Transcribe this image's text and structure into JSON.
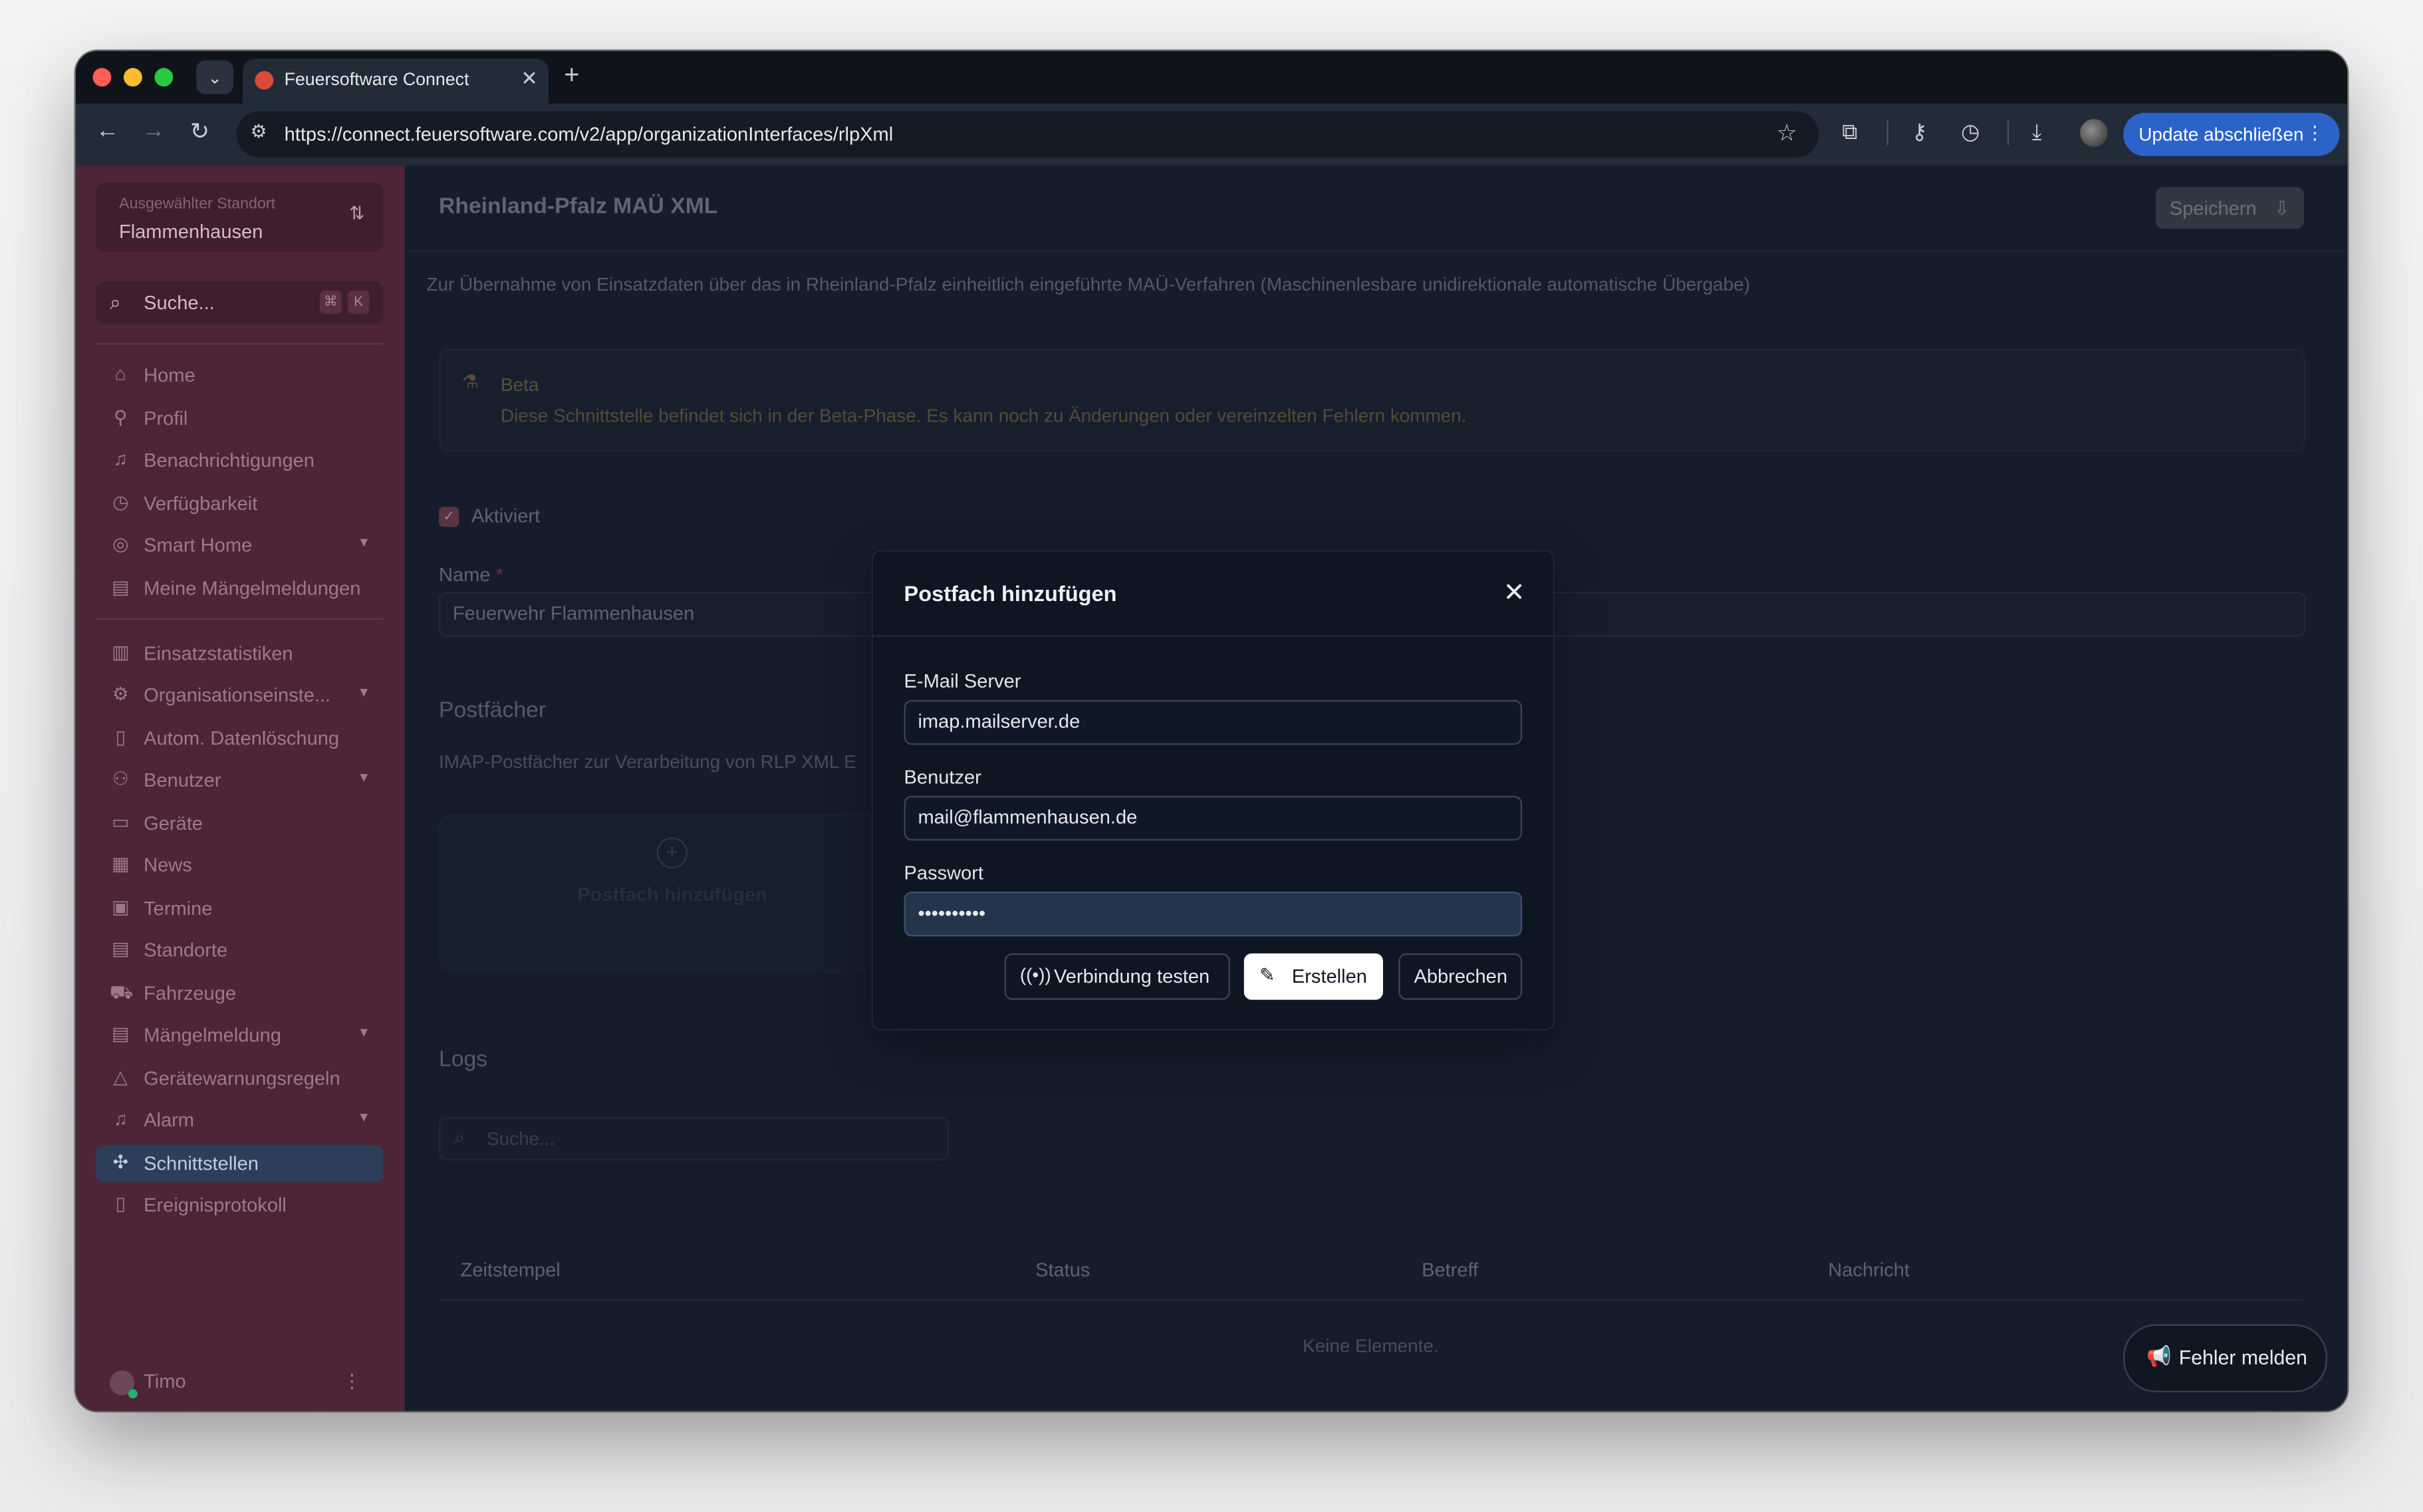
{
  "browser": {
    "tab_title": "Feuersoftware Connect",
    "url": "https://connect.feuersoftware.com/v2/app/organizationInterfaces/rlpXml",
    "update_label": "Update abschließen"
  },
  "sidebar": {
    "location_label": "Ausgewählter Standort",
    "location_value": "Flammenhausen",
    "search_placeholder": "Suche...",
    "kbd_cmd": "⌘",
    "kbd_k": "K",
    "items": [
      {
        "label": "Home",
        "icon": "home-icon"
      },
      {
        "label": "Profil",
        "icon": "user-icon"
      },
      {
        "label": "Benachrichtigungen",
        "icon": "bell-icon"
      },
      {
        "label": "Verfügbarkeit",
        "icon": "clock-icon"
      },
      {
        "label": "Smart Home",
        "icon": "smart-home-icon"
      },
      {
        "label": "Meine Mängelmeldungen",
        "icon": "clipboard-icon"
      },
      {
        "label": "Einsatzstatistiken",
        "icon": "bar-chart-icon"
      },
      {
        "label": "Organisationseinste...",
        "icon": "gear-icon"
      },
      {
        "label": "Autom. Datenlöschung",
        "icon": "trash-icon"
      },
      {
        "label": "Benutzer",
        "icon": "users-icon"
      },
      {
        "label": "Geräte",
        "icon": "monitor-icon"
      },
      {
        "label": "News",
        "icon": "newspaper-icon"
      },
      {
        "label": "Termine",
        "icon": "calendar-icon"
      },
      {
        "label": "Standorte",
        "icon": "building-icon"
      },
      {
        "label": "Fahrzeuge",
        "icon": "truck-icon"
      },
      {
        "label": "Mängelmeldung",
        "icon": "clipboard-icon"
      },
      {
        "label": "Gerätewarnungsregeln",
        "icon": "warning-icon"
      },
      {
        "label": "Alarm",
        "icon": "bell-icon"
      },
      {
        "label": "Schnittstellen",
        "icon": "puzzle-icon"
      },
      {
        "label": "Ereignisprotokoll",
        "icon": "file-icon"
      }
    ],
    "user_name": "Timo"
  },
  "main": {
    "title": "Rheinland-Pfalz MAÜ XML",
    "save_label": "Speichern",
    "description": "Zur Übernahme von Einsatzdaten über das in Rheinland-Pfalz einheitlich eingeführte MAÜ-Verfahren (Maschinenlesbare unidirektionale automatische Übergabe)",
    "beta_title": "Beta",
    "beta_text": "Diese Schnittstelle befindet sich in der Beta-Phase. Es kann noch zu Änderungen oder vereinzelten Fehlern kommen.",
    "activated_label": "Aktiviert",
    "activated": true,
    "name_label": "Name",
    "name_value": "Feuerwehr Flammenhausen",
    "mailboxes_title": "Postfächer",
    "mailboxes_desc": "IMAP-Postfächer zur Verarbeitung von RLP XML E",
    "add_mailbox_label": "Postfach hinzufügen",
    "logs_title": "Logs",
    "logs_search_placeholder": "Suche...",
    "columns": [
      "Zeitstempel",
      "Status",
      "Betreff",
      "Nachricht"
    ],
    "empty_text": "Keine Elemente.",
    "report_label": "Fehler melden"
  },
  "modal": {
    "title": "Postfach hinzufügen",
    "server_label": "E-Mail Server",
    "server_value": "imap.mailserver.de",
    "user_label": "Benutzer",
    "user_value": "mail@flammenhausen.de",
    "password_label": "Passwort",
    "password_value": "••••••••••",
    "test_label": "Verbindung testen",
    "create_label": "Erstellen",
    "cancel_label": "Abbrechen"
  }
}
